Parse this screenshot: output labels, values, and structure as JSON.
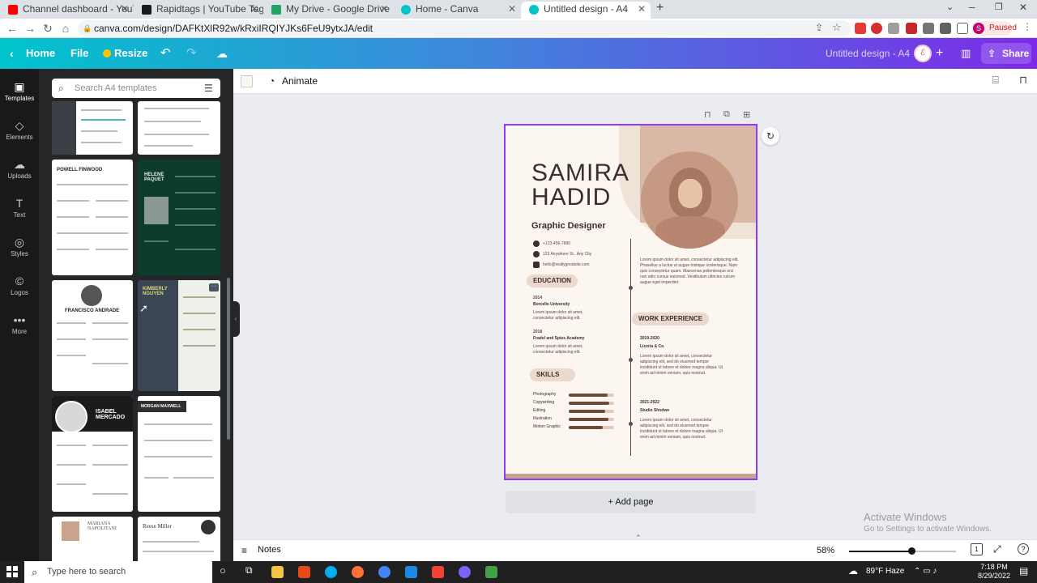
{
  "browser": {
    "tabs": [
      {
        "title": "Channel dashboard - YouTube St",
        "favicon_color": "#ff0000"
      },
      {
        "title": "Rapidtags | YouTube Tag Generat",
        "favicon_color": "#1a1a1a"
      },
      {
        "title": "My Drive - Google Drive",
        "favicon_color": "#1fa463"
      },
      {
        "title": "Home - Canva",
        "favicon_color": "#00c4cc"
      },
      {
        "title": "Untitled design - A4",
        "favicon_color": "#00c4cc"
      }
    ],
    "url": "canva.com/design/DAFKtXlR92w/kRxiIRQIYJKs6FeU9ytxJA/edit",
    "profile_initial": "S",
    "profile_status": "Paused"
  },
  "canva": {
    "home_label": "Home",
    "file_label": "File",
    "resize_label": "Resize",
    "doc_title": "Untitled design - A4",
    "share_label": "Share",
    "rail": [
      {
        "label": "Templates",
        "icon": "templates-icon"
      },
      {
        "label": "Elements",
        "icon": "elements-icon"
      },
      {
        "label": "Uploads",
        "icon": "uploads-icon"
      },
      {
        "label": "Text",
        "icon": "text-icon"
      },
      {
        "label": "Styles",
        "icon": "styles-icon"
      },
      {
        "label": "Logos",
        "icon": "logos-icon"
      },
      {
        "label": "More",
        "icon": "more-icon"
      }
    ],
    "search_placeholder": "Search A4 templates",
    "templates": [
      {
        "name": "POWELL FINWOOD"
      },
      {
        "name": "HELENE PAQUET"
      },
      {
        "name": "FRANCISCO ANDRADE"
      },
      {
        "name": "KIMBERLY NGUYEN"
      },
      {
        "name": "ISABEL MERCADO"
      },
      {
        "name": "MORGAN MAXWELL"
      },
      {
        "name": "MARIANA NAPOLITANI"
      },
      {
        "name": "Reese Miller"
      }
    ],
    "animate_label": "Animate",
    "add_page_label": "+ Add page",
    "notes_label": "Notes",
    "zoom": "58%",
    "zoom_fraction": 0.58
  },
  "resume": {
    "first_name": "SAMIRA",
    "last_name": "HADID",
    "role": "Graphic Designer",
    "phone": "+123-456-7890",
    "address": "123 Anywhere St., Any City",
    "email": "hello@reallygreatsite.com",
    "profile_text": "Lorem ipsum dolor sit amet, consectetur adipiscing elit. Phasellus a luctus ut augue tristique scelerisque. Nam quis consectetur quam. Maecenas pellentesque orci non odio cursus euismod. Vestibulum ultricies rutrum augue eget imperdiet.",
    "education_title": "EDUCATION",
    "education": [
      {
        "year": "2014",
        "school": "Borcelle University",
        "text": "Lorem ipsum dolor sit amet, consectetur adipiscing elit."
      },
      {
        "year": "2018",
        "school": "Fradel and Spies Academy",
        "text": "Lorem ipsum dolor sit amet, consectetur adipiscing elit."
      }
    ],
    "skills_title": "SKILLS",
    "skills": [
      {
        "name": "Photography",
        "level": 0.85
      },
      {
        "name": "Copywriting",
        "level": 0.9
      },
      {
        "name": "Editing",
        "level": 0.8
      },
      {
        "name": "Illustration",
        "level": 0.88
      },
      {
        "name": "Motion Graphic",
        "level": 0.75
      }
    ],
    "work_title": "WORK EXPERIENCE",
    "work": [
      {
        "years": "2019-2020",
        "company": "Liceria & Co.",
        "text": "Lorem ipsum dolor sit amet, consectetur adipiscing elit, sed do eiusmod tempor incididunt ut labore et dolore magna aliqua. Ut enim ad minim veniam, quis nostrud."
      },
      {
        "years": "2021-2022",
        "company": "Studio Shodwe",
        "text": "Lorem ipsum dolor sit amet, consectetur adipiscing elit, sed do eiusmod tempor incididunt ut labore et dolore magna aliqua. Ut enim ad minim veniam, quis nostrud."
      }
    ]
  },
  "windows": {
    "activate_title": "Activate Windows",
    "activate_sub": "Go to Settings to activate Windows.",
    "search_placeholder": "Type here to search",
    "weather": "89°F  Haze",
    "time": "7:18 PM",
    "date": "8/29/2022"
  }
}
